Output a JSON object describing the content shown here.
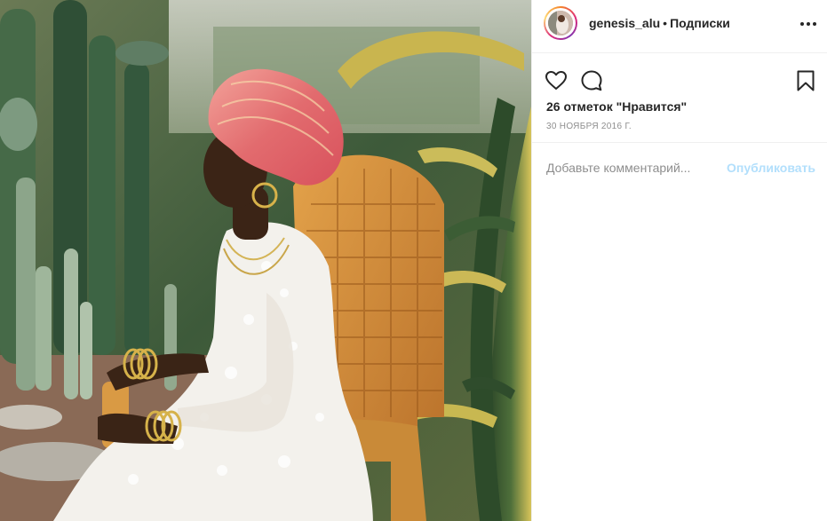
{
  "post": {
    "username": "genesis_alu",
    "separator": "•",
    "follow_label": "Подписки",
    "likes_text": "26 отметок \"Нравится\"",
    "date": "30 ноября 2016 г.",
    "comment_placeholder": "Добавьте комментарий...",
    "publish_label": "Опубликовать"
  },
  "icons": {
    "more": "more-options-icon",
    "like": "heart-icon",
    "comment": "comment-bubble-icon",
    "save": "bookmark-icon"
  },
  "colors": {
    "text": "#262626",
    "muted": "#8e8e8e",
    "publish_disabled": "#b2dffc",
    "divider": "#efefef"
  }
}
